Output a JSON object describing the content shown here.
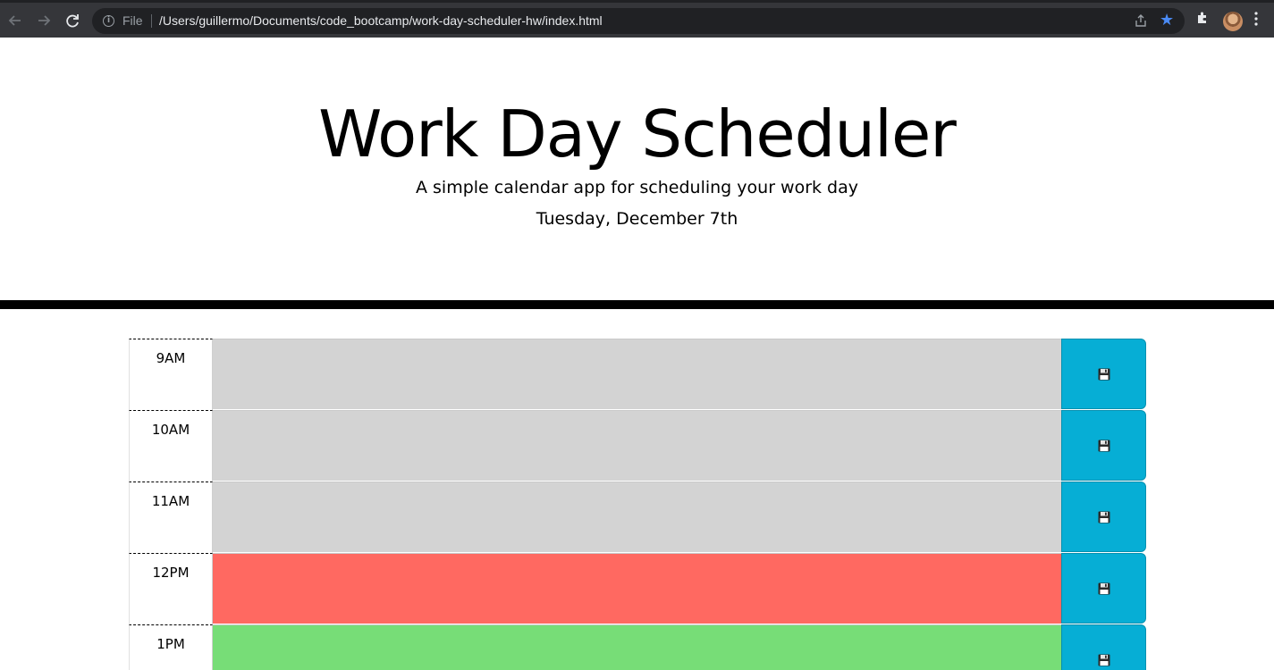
{
  "browser": {
    "scheme_label": "File",
    "url": "/Users/guillermo/Documents/code_bootcamp/work-day-scheduler-hw/index.html",
    "icons": [
      "back-icon",
      "forward-icon",
      "reload-icon",
      "info-icon",
      "share-icon",
      "bookmark-star-icon",
      "extensions-icon",
      "profile-avatar",
      "menu-icon"
    ],
    "star_color": "#4a8af4"
  },
  "header": {
    "title": "Work Day Scheduler",
    "lead": "A simple calendar app for scheduling your work day",
    "current_day": "Tuesday, December 7th"
  },
  "colors": {
    "past": "#d3d3d3",
    "present": "#ff6961",
    "future": "#77dd77",
    "save_button": "#06aed5"
  },
  "time_blocks": [
    {
      "hour": "9AM",
      "state": "past",
      "text": ""
    },
    {
      "hour": "10AM",
      "state": "past",
      "text": ""
    },
    {
      "hour": "11AM",
      "state": "past",
      "text": ""
    },
    {
      "hour": "12PM",
      "state": "present",
      "text": ""
    },
    {
      "hour": "1PM",
      "state": "future",
      "text": ""
    }
  ]
}
